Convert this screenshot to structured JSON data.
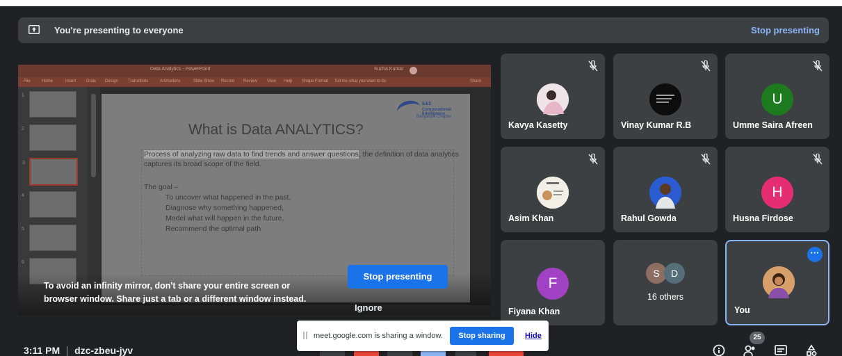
{
  "banner": {
    "message": "You're presenting to everyone",
    "stop_link": "Stop presenting"
  },
  "presentation": {
    "window_title": "Data Analytics - PowerPoint",
    "user_label": "Sucha Kumar",
    "ribbon_tabs": [
      "File",
      "Home",
      "Insert",
      "Draw",
      "Design",
      "Transitions",
      "Animations",
      "Slide Show",
      "Record",
      "Review",
      "View",
      "Help",
      "Shape Format",
      "Tell me what you want to do",
      "Share"
    ],
    "slide_title": "What is Data ANALYTICS?",
    "highlighted_text": "Process of analyzing raw data to find trends and answer questions",
    "body_text": ", the definition of data analytics captures its broad scope of the field.",
    "goal_heading": "The goal –",
    "goal_items": [
      "To uncover what happened in the past,",
      "Diagnose why something happened,",
      "Model what will happen in the future,",
      "Recommend the optimal path"
    ],
    "logo": {
      "line1": "IEEE",
      "line2": "Computational Intelligence",
      "line3": "Bangalore Chapter"
    },
    "thumb_numbers": [
      "1",
      "2",
      "3",
      "4",
      "5",
      "6"
    ]
  },
  "mirror_warning": {
    "line1": "To avoid an infinity mirror, don't share your entire screen or",
    "line2": "browser window. Share just a tab or a different window instead.",
    "stop_button": "Stop presenting",
    "ignore_button": "Ignore"
  },
  "participants": [
    {
      "name": "Kavya Kasetty",
      "avatar": "photo",
      "muted": true
    },
    {
      "name": "Vinay Kumar R.B",
      "avatar": "photo",
      "muted": true
    },
    {
      "name": "Umme Saira Afreen",
      "initial": "U",
      "color": "#1e7a1e",
      "muted": true
    },
    {
      "name": "Asim Khan",
      "avatar": "photo",
      "muted": true
    },
    {
      "name": "Rahul Gowda",
      "avatar": "photo",
      "muted": true
    },
    {
      "name": "Husna Firdose",
      "initial": "H",
      "color": "#e52e71",
      "muted": true
    },
    {
      "name": "Fiyana Khan",
      "initial": "F",
      "color": "#a142c4",
      "muted": false
    },
    {
      "name": "",
      "others_label": "16 others",
      "mini_initials": [
        "S",
        "D"
      ],
      "muted": false
    },
    {
      "name": "You",
      "avatar": "photo",
      "muted": false
    }
  ],
  "meeting": {
    "time": "3:11 PM",
    "code": "dzc-zbeu-jyv",
    "participant_count": "25"
  },
  "share_bar": {
    "message": "meet.google.com is sharing a window.",
    "stop_button": "Stop sharing",
    "hide_link": "Hide"
  },
  "colors": {
    "accent": "#1a73e8",
    "link": "#8ab4f8",
    "background": "#202124",
    "tile": "#3c4043"
  }
}
